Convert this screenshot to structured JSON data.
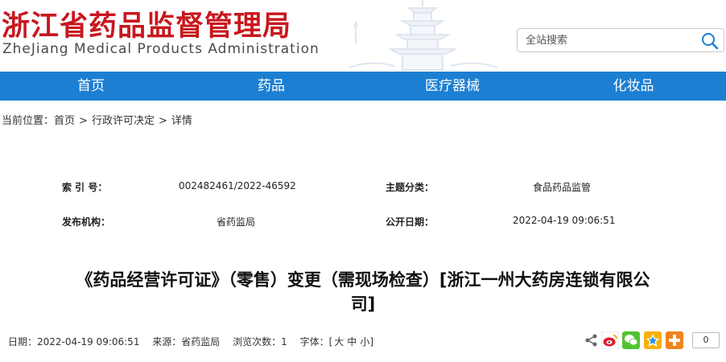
{
  "header": {
    "title_cn": "浙江省药品监督管理局",
    "title_en": "ZheJiang Medical Products Administration",
    "search_placeholder": "全站搜索"
  },
  "nav": {
    "items": [
      {
        "label": "首页"
      },
      {
        "label": "药品"
      },
      {
        "label": "医疗器械"
      },
      {
        "label": "化妆品"
      }
    ]
  },
  "breadcrumb": {
    "prefix": "当前位置：",
    "items": [
      "首页",
      "行政许可决定",
      "详情"
    ],
    "sep": ">"
  },
  "meta": {
    "index_label": "索 引 号：",
    "index_value": "002482461/2022-46592",
    "topic_label": "主题分类：",
    "topic_value": "食品药品监管",
    "publisher_label": "发布机构：",
    "publisher_value": "省药监局",
    "date_label": "公开日期：",
    "date_value": "2022-04-19 09:06:51"
  },
  "article": {
    "title_line1": "《药品经营许可证》（零售）变更（需现场检查）[浙江一州大药房连锁有限公",
    "title_line2": "司]"
  },
  "info": {
    "date": "日期：2022-04-19 09:06:51",
    "source": "来源：省药监局",
    "views": "浏览次数：1",
    "font_prefix": "字体：[",
    "font_large": "大",
    "font_medium": "中",
    "font_small": "小",
    "font_suffix": "]"
  },
  "share": {
    "icons": [
      "share-icon",
      "weibo-icon",
      "wechat-icon",
      "qzone-icon",
      "more-share-icon"
    ],
    "count": "0"
  },
  "colors": {
    "brand_red": "#c8171e",
    "nav_blue": "#1c7fd2"
  }
}
